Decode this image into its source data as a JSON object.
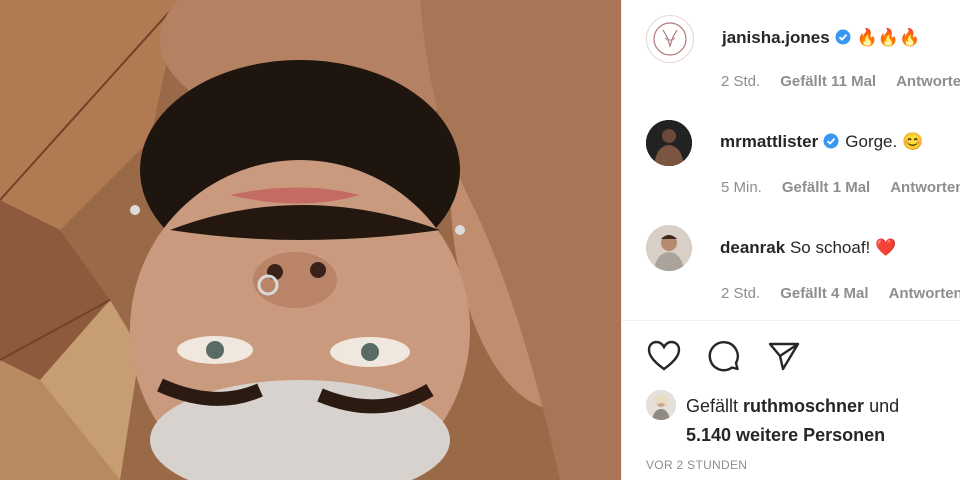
{
  "comments": [
    {
      "username": "janisha.jones",
      "verified": true,
      "text": "🔥🔥🔥",
      "time": "2 Std.",
      "likes": "Gefällt 11 Mal",
      "reply": "Antworten"
    },
    {
      "username": "mrmattlister",
      "verified": true,
      "text": "Gorge. 😊",
      "time": "5 Min.",
      "likes": "Gefällt 1 Mal",
      "reply": "Antworten"
    },
    {
      "username": "deanrak",
      "verified": false,
      "text": "So schoaf! ❤️",
      "time": "2 Std.",
      "likes": "Gefällt 4 Mal",
      "reply": "Antworten"
    }
  ],
  "actions": {
    "like_icon": "heart-icon",
    "comment_icon": "comment-bubble-icon",
    "share_icon": "paper-plane-icon"
  },
  "liked_by": {
    "prefix": "Gefällt",
    "user": "ruthmoschner",
    "conjunction": "und",
    "others": "5.140 weitere Personen"
  },
  "timestamp": "VOR 2 STUNDEN",
  "colors": {
    "verified_blue": "#3897f0",
    "secondary_text": "#8e8e8e",
    "primary_text": "#262626"
  }
}
